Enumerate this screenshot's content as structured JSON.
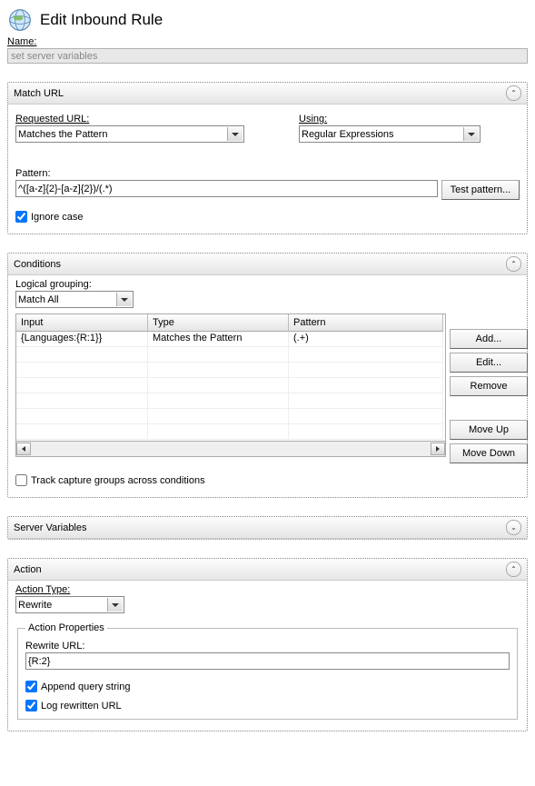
{
  "page_title": "Edit Inbound Rule",
  "name_label": "Name:",
  "name_value": "set server variables",
  "matchUrl": {
    "section_title": "Match URL",
    "requested_url_label": "Requested URL:",
    "requested_url_value": "Matches the Pattern",
    "using_label": "Using:",
    "using_value": "Regular Expressions",
    "pattern_label": "Pattern:",
    "pattern_value": "^([a-z]{2}-[a-z]{2})/(.*)",
    "test_pattern_btn": "Test pattern...",
    "ignore_case_label": "Ignore case",
    "ignore_case_checked": true
  },
  "conditions": {
    "section_title": "Conditions",
    "logical_grouping_label": "Logical grouping:",
    "logical_grouping_value": "Match All",
    "columns": {
      "input": "Input",
      "type": "Type",
      "pattern": "Pattern"
    },
    "rows": [
      {
        "input": "{Languages:{R:1}}",
        "type": "Matches the Pattern",
        "pattern": "(.+)"
      }
    ],
    "buttons": {
      "add": "Add...",
      "edit": "Edit...",
      "remove": "Remove",
      "moveUp": "Move Up",
      "moveDown": "Move Down"
    },
    "track_capture_label": "Track capture groups across conditions",
    "track_capture_checked": false
  },
  "serverVariables": {
    "section_title": "Server Variables"
  },
  "action": {
    "section_title": "Action",
    "action_type_label": "Action Type:",
    "action_type_value": "Rewrite",
    "properties_legend": "Action Properties",
    "rewrite_url_label": "Rewrite URL:",
    "rewrite_url_value": "{R:2}",
    "append_qs_label": "Append query string",
    "append_qs_checked": true,
    "log_rewritten_label": "Log rewritten URL",
    "log_rewritten_checked": true
  }
}
